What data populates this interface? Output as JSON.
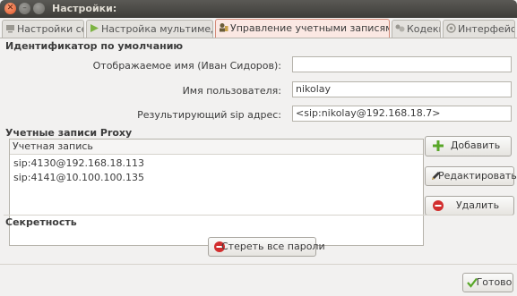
{
  "window": {
    "title": "Настройки:"
  },
  "tabs": [
    {
      "label": "Настройки сети",
      "icon": "network-icon",
      "active": false
    },
    {
      "label": "Настройка мультимедиа",
      "icon": "play-icon",
      "active": false
    },
    {
      "label": "Управление учетными записями SIP",
      "icon": "accounts-icon",
      "active": true
    },
    {
      "label": "Кодеки",
      "icon": "codecs-icon",
      "active": false
    },
    {
      "label": "Интерфейс:",
      "icon": "interface-icon",
      "active": false
    }
  ],
  "identity": {
    "section_title": "Идентификатор по умолчанию",
    "display_name_label": "Отображаемое имя (Иван Сидоров):",
    "display_name_value": "",
    "username_label": "Имя пользователя:",
    "username_value": "nikolay",
    "sip_address_label": "Результирующий sip адрес:",
    "sip_address_value": "<sip:nikolay@192.168.18.7>"
  },
  "proxy": {
    "section_title": "Учетные записи Proxy",
    "column_header": "Учетная запись",
    "accounts": [
      "sip:4130@192.168.18.113",
      "sip:4141@10.100.100.135"
    ],
    "add_label": "Добавить",
    "edit_label": "Редактировать",
    "remove_label": "Удалить"
  },
  "privacy": {
    "section_title": "Секретность",
    "erase_label": "Стереть все пароли"
  },
  "footer": {
    "done_label": "Готово"
  },
  "colors": {
    "accent": "#e2572a",
    "active_tab": "#fbe8e3",
    "add_green": "#58a728",
    "remove_red": "#d22e2e"
  }
}
